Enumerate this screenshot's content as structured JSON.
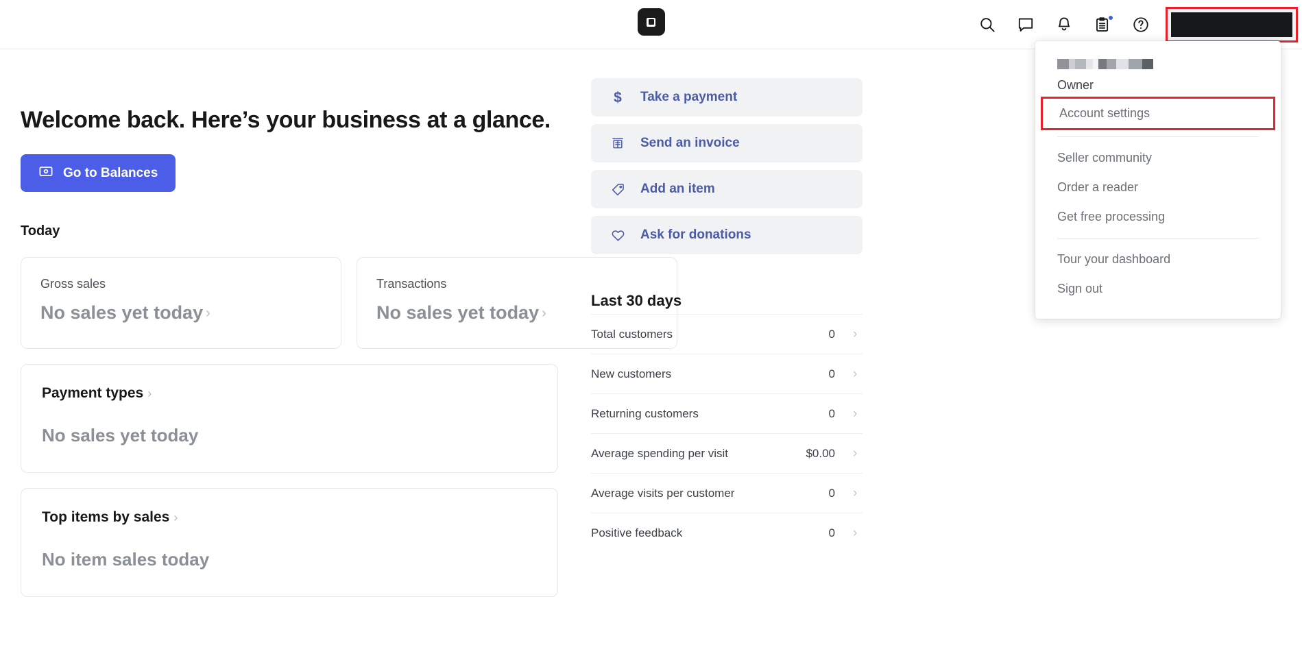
{
  "header": {
    "logo_name": "square-logo",
    "icons": [
      {
        "name": "search-icon",
        "label": "Search"
      },
      {
        "name": "messages-icon",
        "label": "Messages"
      },
      {
        "name": "notifications-bell-icon",
        "label": "Notifications"
      },
      {
        "name": "tasks-clipboard-icon",
        "label": "Tasks",
        "badge": true
      },
      {
        "name": "help-icon",
        "label": "Help"
      }
    ],
    "account_button_label": ""
  },
  "main": {
    "welcome_title": "Welcome back. Here’s your business at a glance.",
    "balances_button": "Go to Balances",
    "balances_icon": "balance-card-icon",
    "today_heading": "Today",
    "today_cards": [
      {
        "label": "Gross sales",
        "value": "No sales yet today"
      },
      {
        "label": "Transactions",
        "value": "No sales yet today"
      }
    ],
    "payment_types": {
      "title": "Payment types",
      "empty": "No sales yet today"
    },
    "top_items": {
      "title": "Top items by sales",
      "empty": "No item sales today"
    }
  },
  "actions": [
    {
      "icon": "dollar-icon",
      "label": "Take a payment"
    },
    {
      "icon": "invoice-icon",
      "label": "Send an invoice"
    },
    {
      "icon": "tag-icon",
      "label": "Add an item"
    },
    {
      "icon": "heart-icon",
      "label": "Ask for donations"
    }
  ],
  "last30": {
    "heading": "Last 30 days",
    "rows": [
      {
        "label": "Total customers",
        "value": "0"
      },
      {
        "label": "New customers",
        "value": "0"
      },
      {
        "label": "Returning customers",
        "value": "0"
      },
      {
        "label": "Average spending per visit",
        "value": "$0.00"
      },
      {
        "label": "Average visits per customer",
        "value": "0"
      },
      {
        "label": "Positive feedback",
        "value": "0"
      }
    ]
  },
  "dropdown": {
    "user_name_redacted": "",
    "role": "Owner",
    "account_settings": "Account settings",
    "group_two": [
      {
        "label": "Seller community"
      },
      {
        "label": "Order a reader"
      },
      {
        "label": "Get free processing"
      }
    ],
    "group_three": [
      {
        "label": "Tour your dashboard"
      },
      {
        "label": "Sign out"
      }
    ]
  },
  "colors": {
    "accent_blue": "#4c5ee8",
    "action_text": "#4b5ba6",
    "highlight_red": "#e8212b",
    "badge_blue": "#3e63dd"
  }
}
